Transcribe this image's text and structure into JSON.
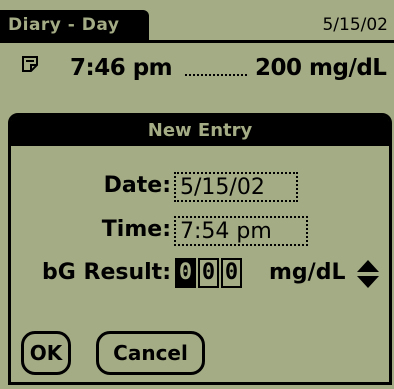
{
  "titlebar": {
    "title": "Diary - Day",
    "date": "5/15/02"
  },
  "entry": {
    "icon": "note-icon",
    "time": "7:46 pm",
    "value": "200 mg/dL"
  },
  "dialog": {
    "title": "New Entry",
    "date_label": "Date:",
    "date_value": "5/15/02",
    "time_label": "Time:",
    "time_value": "7:54 pm",
    "bg_label": "bG Result:",
    "bg_digits": [
      "0",
      "0",
      "0"
    ],
    "unit": "mg/dL",
    "ok_label": "OK",
    "cancel_label": "Cancel"
  },
  "colors": {
    "screen": "#a4ac85",
    "ink": "#000000"
  }
}
